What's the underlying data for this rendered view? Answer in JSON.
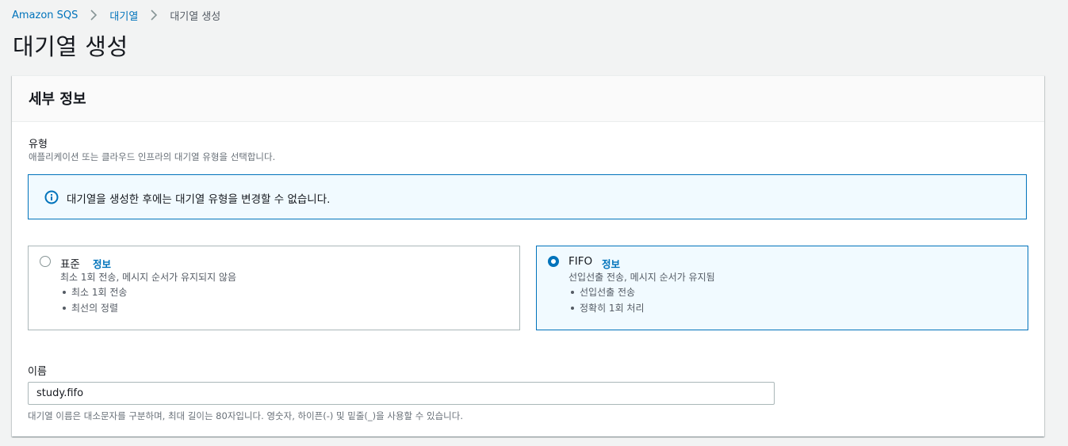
{
  "breadcrumb": {
    "items": [
      {
        "label": "Amazon SQS"
      },
      {
        "label": "대기열"
      },
      {
        "label": "대기열 생성"
      }
    ]
  },
  "page": {
    "title": "대기열 생성"
  },
  "details": {
    "title": "세부 정보",
    "type": {
      "label": "유형",
      "description": "애플리케이션 또는 클라우드 인프라의 대기열 유형을 선택합니다.",
      "alert": "대기열을 생성한 후에는 대기열 유형을 변경할 수 없습니다.",
      "options": [
        {
          "title": "표준",
          "info": "정보",
          "description": "최소 1회 전송, 메시지 순서가 유지되지 않음",
          "bullets": [
            "최소 1회 전송",
            "최선의 정렬"
          ],
          "selected": false
        },
        {
          "title": "FIFO",
          "info": "정보",
          "description": "선입선출 전송, 메시지 순서가 유지됨",
          "bullets": [
            "선입선출 전송",
            "정확히 1회 처리"
          ],
          "selected": true
        }
      ]
    },
    "name": {
      "label": "이름",
      "value": "study.fifo",
      "constraint": "대기열 이름은 대소문자를 구분하며, 최대 길이는 80자입니다. 영숫자, 하이픈(-) 및 밑줄(_)을 사용할 수 있습니다."
    }
  },
  "colors": {
    "link": "#0073bb",
    "selected_border": "#0073bb",
    "selected_bg": "#f1faff",
    "page_bg": "#f2f3f3"
  }
}
